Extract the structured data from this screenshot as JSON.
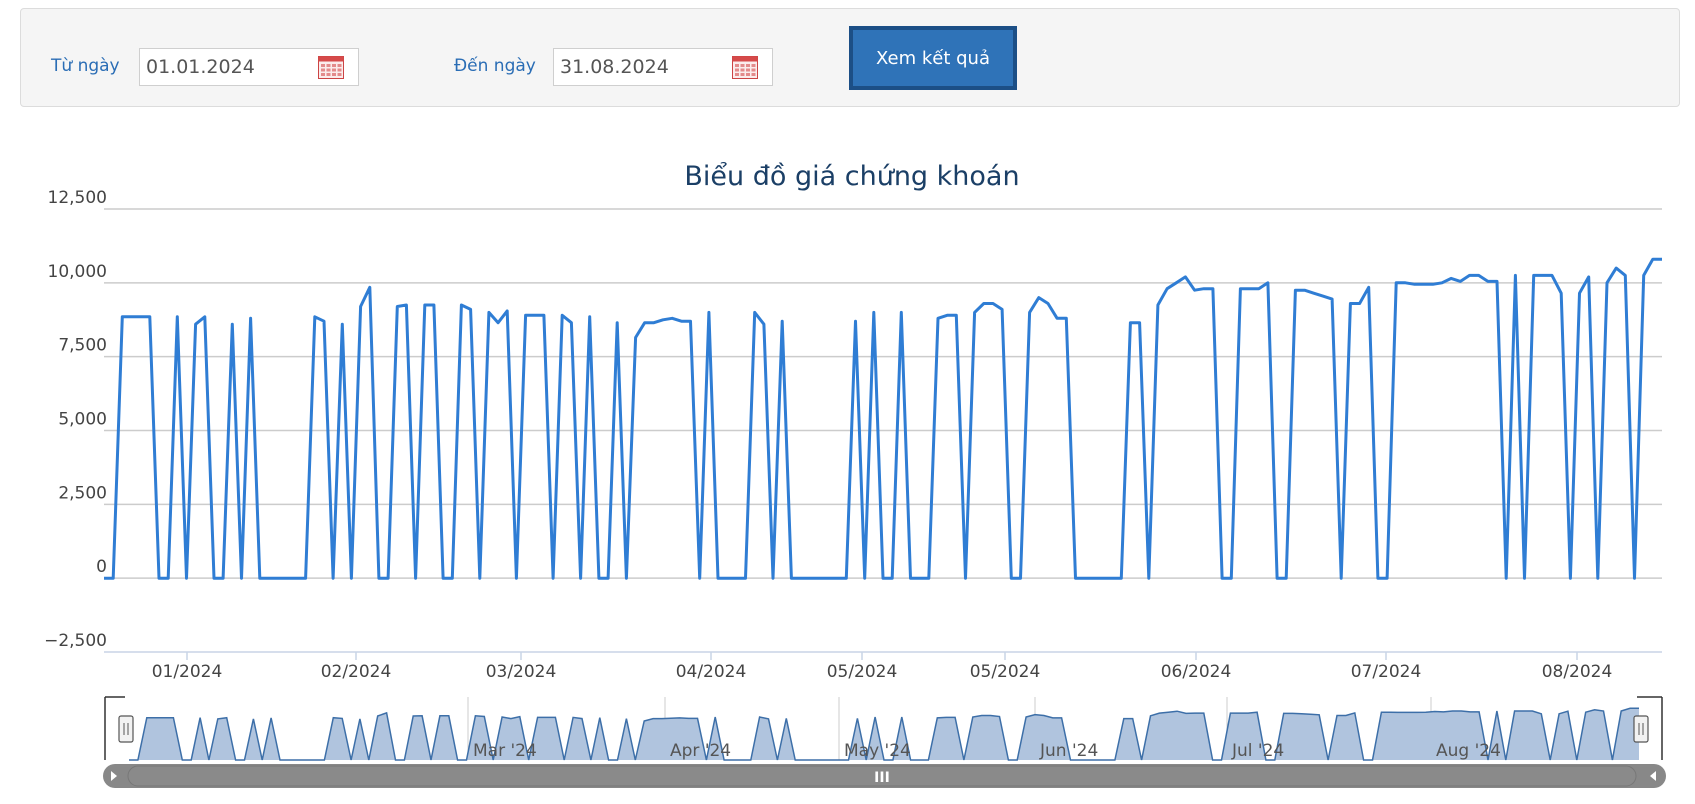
{
  "filters": {
    "from_label": "Từ ngày",
    "from_value": "01.01.2024",
    "to_label": "Đến ngày",
    "to_value": "31.08.2024",
    "submit_label": "Xem kết quả"
  },
  "navigator": {
    "labels": [
      "Mar '24",
      "Apr '24",
      "May '24",
      "Jun '24",
      "Jul '24",
      "Aug '24"
    ],
    "scroll_grip": "III"
  },
  "colors": {
    "line": "#2f7dd4",
    "navigator_fill": "#b0c4de",
    "navigator_line": "#3d6fa8",
    "button": "#2f73b8"
  },
  "icons": {
    "calendar": "calendar-icon",
    "scroll_left": "arrow-left-icon",
    "scroll_right": "arrow-right-icon"
  },
  "chart_data": {
    "type": "line",
    "title": "Biểu đồ giá chứng khoán",
    "ylim": [
      -2500,
      12500
    ],
    "yticks": [
      12500,
      10000,
      7500,
      5000,
      2500,
      0,
      -2500
    ],
    "ytick_labels": [
      "12,500",
      "10,000",
      "7,500",
      "5,000",
      "2,500",
      "0",
      "−2,500"
    ],
    "xtick_labels": [
      "01/2024",
      "02/2024",
      "03/2024",
      "04/2024",
      "05/2024",
      "05/2024",
      "06/2024",
      "07/2024",
      "08/2024"
    ],
    "grid": true,
    "legend": "none",
    "series": [
      {
        "values": [
          0,
          0,
          8850,
          8850,
          8850,
          8850,
          0,
          0,
          8850,
          0,
          8600,
          8850,
          0,
          0,
          8600,
          0,
          8800,
          0,
          0,
          0,
          0,
          0,
          0,
          8850,
          8700,
          0,
          8600,
          0,
          9200,
          9850,
          0,
          0,
          9200,
          9250,
          0,
          9250,
          9250,
          0,
          0,
          9250,
          9100,
          0,
          9000,
          8650,
          9050,
          0,
          8900,
          8900,
          8900,
          0,
          8900,
          8650,
          0,
          8850,
          0,
          0,
          8650,
          0,
          8150,
          8650,
          8650,
          8750,
          8800,
          8700,
          8700,
          0,
          9000,
          0,
          0,
          0,
          0,
          9000,
          8600,
          0,
          8700,
          0,
          0,
          0,
          0,
          0,
          0,
          0,
          8700,
          0,
          9000,
          0,
          0,
          9000,
          0,
          0,
          0,
          8800,
          8900,
          8900,
          0,
          9000,
          9300,
          9300,
          9100,
          0,
          0,
          9000,
          9500,
          9300,
          8800,
          8800,
          0,
          0,
          0,
          0,
          0,
          0,
          8650,
          8650,
          0,
          9250,
          9800,
          10000,
          10200,
          9750,
          9800,
          9800,
          0,
          0,
          9800,
          9800,
          9800,
          10000,
          0,
          0,
          9750,
          9750,
          9650,
          9550,
          9450,
          0,
          9300,
          9300,
          9850,
          0,
          0,
          10000,
          10000,
          9950,
          9950,
          9950,
          10000,
          10150,
          10050,
          10250,
          10250,
          10050,
          10050,
          0,
          10250,
          0,
          10250,
          10250,
          10250,
          9650,
          0,
          9650,
          10200,
          0,
          10000,
          10500,
          10250,
          0,
          10250,
          10800,
          10800
        ]
      }
    ]
  }
}
